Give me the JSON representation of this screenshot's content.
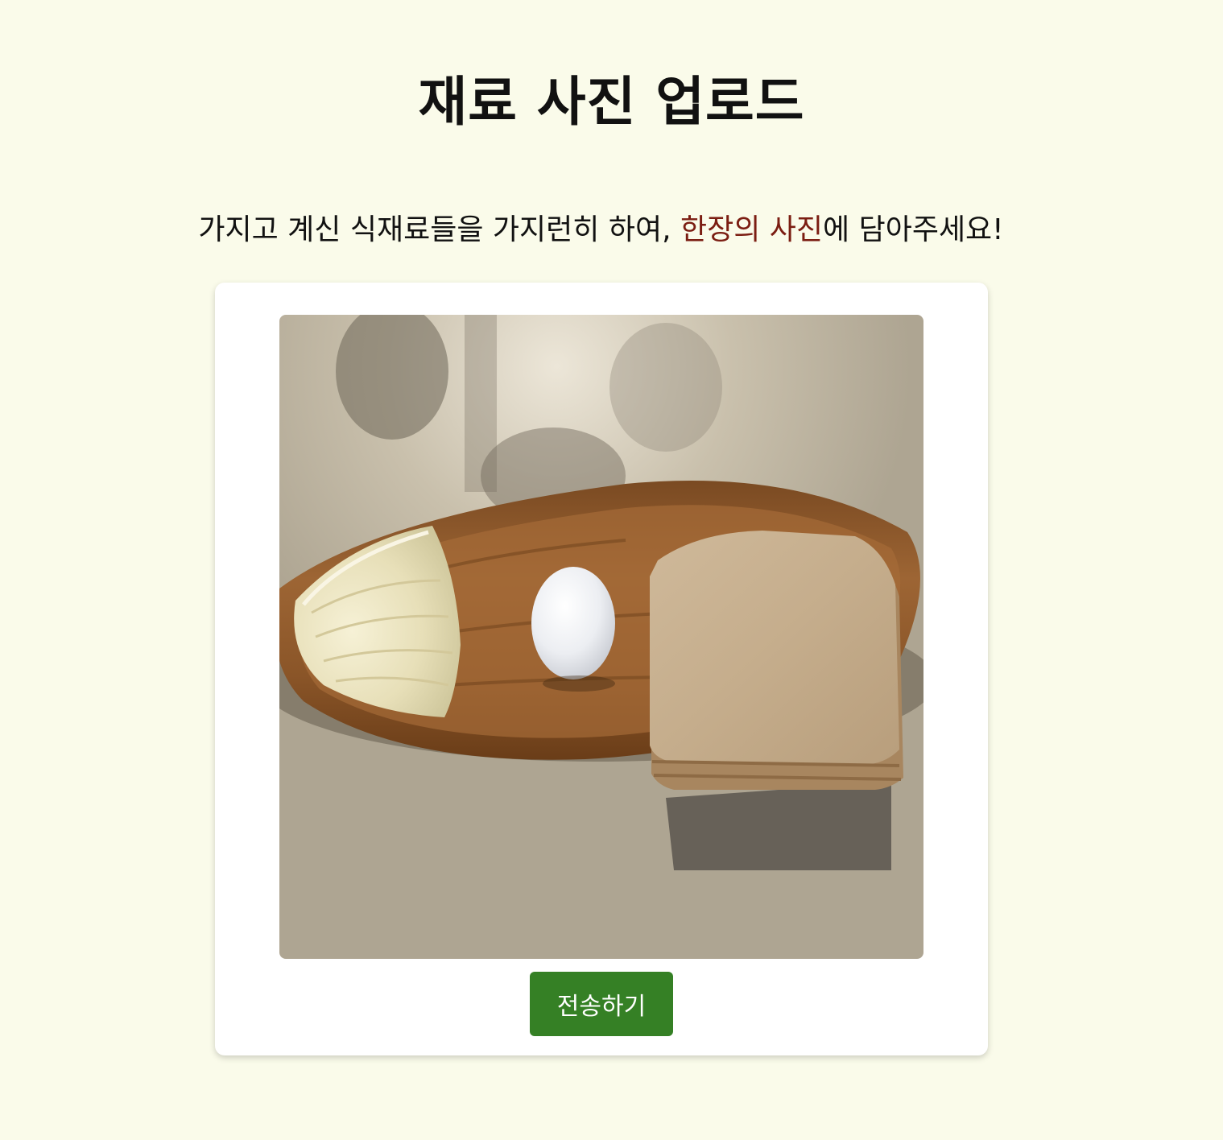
{
  "page": {
    "title": "재료 사진 업로드"
  },
  "instruction": {
    "before": "가지고 계신 식재료들을 가지런히 하여, ",
    "highlight": "한장의 사진",
    "after": "에 담아주세요!"
  },
  "upload": {
    "photo_subject": "cabbage, egg and bread slices on a wooden tray",
    "submit_label": "전송하기"
  },
  "colors": {
    "background": "#fafbea",
    "highlight": "#7b1d12",
    "button": "#358025"
  }
}
